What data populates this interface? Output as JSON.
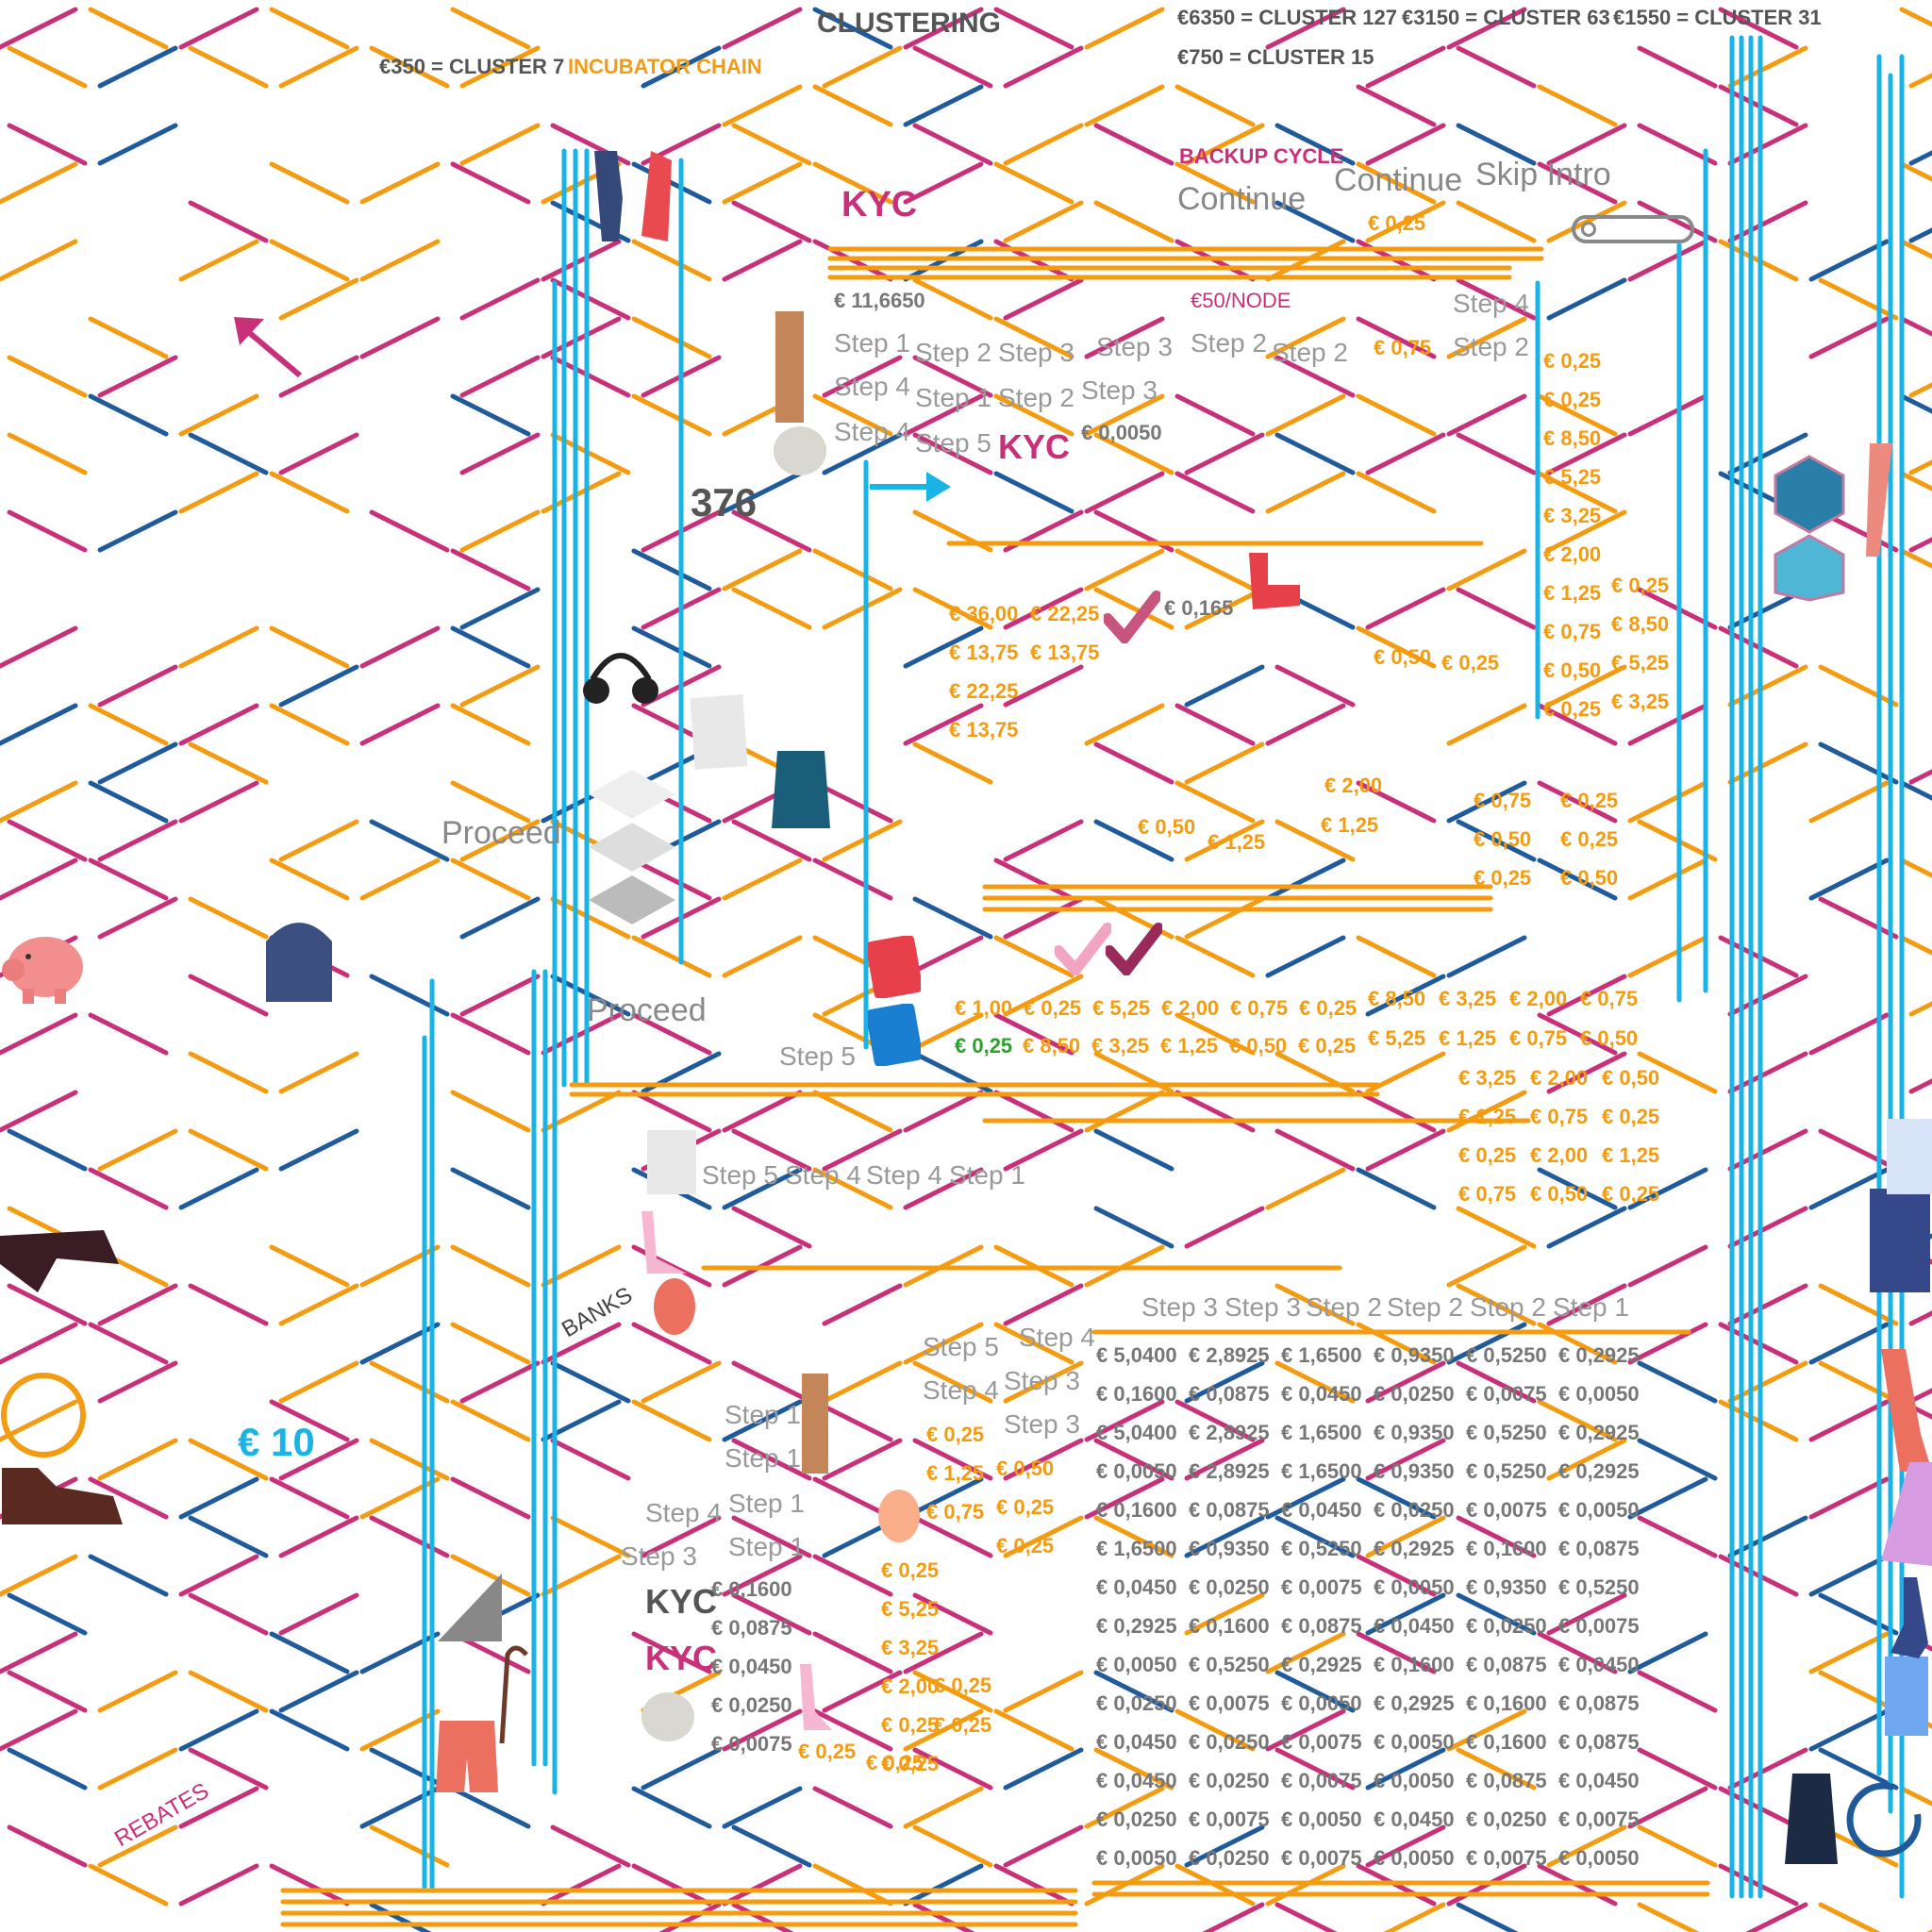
{
  "header": {
    "clustering": "CLUSTERING",
    "cluster7": "€350 = CLUSTER 7",
    "incubator_chain": "INCUBATOR CHAIN",
    "cluster127": "€6350 = CLUSTER 127",
    "cluster63": "€3150 = CLUSTER 63",
    "cluster31": "€1550 = CLUSTER 31",
    "cluster15": "€750 = CLUSTER 15"
  },
  "controls": {
    "backup_cycle": "BACKUP CYCLE",
    "continue_1": "Continue",
    "continue_2": "Continue",
    "skip_intro": "Skip Intro",
    "fee_025": "€ 0,25",
    "proceed_1": "Proceed",
    "proceed_2": "Proceed"
  },
  "labels": {
    "kyc": "KYC",
    "total": "€ 11,6650",
    "per_node": "€50/NODE",
    "small_fee": "€ 0,0050",
    "fee_0165": "€ 0,165",
    "count": "376",
    "banks": "BANKS",
    "rebates": "REBATES",
    "ten": "€ 10"
  },
  "steps_top": [
    "Step 1",
    "Step 4",
    "Step 4",
    "Step 2",
    "Step 1",
    "Step 5",
    "Step 3",
    "Step 2",
    "Step 3",
    "Step 3",
    "Step 2",
    "Step 2",
    "Step 4",
    "Step 2"
  ],
  "step5_mid": "Step 5",
  "steps_row": [
    "Step 5",
    "Step 4",
    "Step 4",
    "Step 1"
  ],
  "steps_row2": [
    "Step 3",
    "Step 3",
    "Step 2",
    "Step 2",
    "Step 2",
    "Step 1"
  ],
  "steps_lower": [
    "Step 5",
    "Step 4",
    "Step 4",
    "Step 3",
    "Step 3"
  ],
  "steps_left": [
    "Step 1",
    "Step 1",
    "Step 1",
    "Step 1",
    "Step 4",
    "Step 3"
  ],
  "amounts": {
    "top_075": "€ 0,75",
    "right_col": [
      "€ 0,25",
      "€ 0,25",
      "€ 8,50",
      "€ 5,25",
      "€ 3,25",
      "€ 2,00",
      "€ 1,25",
      "€ 0,75",
      "€ 0,50",
      "€ 0,25"
    ],
    "right_col2": [
      "€ 0,25",
      "€ 8,50",
      "€ 5,25",
      "€ 3,25"
    ],
    "mid_left": [
      [
        "€ 36,00",
        "€ 22,25"
      ],
      [
        "€ 13,75",
        "€ 13,75"
      ],
      [
        "€ 22,25"
      ],
      [
        "€ 13,75"
      ]
    ],
    "mid_050": "€ 0,50",
    "mid_025": "€ 0,25",
    "cluster_a": [
      "€ 2,00",
      "€ 1,25",
      "€ 0,50",
      "€ 1,25"
    ],
    "cluster_b": [
      [
        "€ 0,75",
        "€ 0,25"
      ],
      [
        "€ 0,50",
        "€ 0,25"
      ],
      [
        "€ 0,25",
        "€ 0,50"
      ]
    ],
    "row1": [
      "€ 1,00",
      "€ 0,25",
      "€ 5,25",
      "€ 2,00",
      "€ 0,75",
      "€ 0,25"
    ],
    "row2_green": "€ 0,25",
    "row2": [
      "€ 8,50",
      "€ 3,25",
      "€ 1,25",
      "€ 0,50",
      "€ 0,25"
    ],
    "row1b": [
      "€ 8,50",
      "€ 3,25",
      "€ 2,00",
      "€ 0,75"
    ],
    "row2b": [
      "€ 5,25",
      "€ 1,25",
      "€ 0,75",
      "€ 0,50"
    ],
    "stack_right": [
      [
        "€ 3,25",
        "€ 2,00",
        "€ 0,50"
      ],
      [
        "€ 1,25",
        "€ 0,75",
        "€ 0,25"
      ],
      [
        "€ 0,25",
        "€ 2,00",
        "€ 1,25"
      ],
      [
        "€ 0,75",
        "€ 0,50",
        "€ 0,25"
      ]
    ],
    "lower_mid": [
      "€ 0,25",
      "€ 1,25",
      "€ 0,75"
    ],
    "lower_mid2": [
      "€ 0,50",
      "€ 0,25",
      "€ 0,25"
    ],
    "lower_left_gray": [
      "€ 0,1600",
      "€ 0,0875",
      "€ 0,0450",
      "€ 0,0250",
      "€ 0,0075"
    ],
    "lower_org": [
      "€ 0,25",
      "€ 5,25",
      "€ 3,25",
      "€ 2,00",
      "€ 0,25",
      "€ 0,25"
    ],
    "lower_org2": [
      "€ 0,25",
      "€ 0,25",
      "€ 0,25",
      "€ 0,25"
    ]
  },
  "table": [
    [
      "€ 5,0400",
      "€ 2,8925",
      "€ 1,6500",
      "€ 0,9350",
      "€ 0,5250",
      "€ 0,2925"
    ],
    [
      "€ 0,1600",
      "€ 0,0875",
      "€ 0,0450",
      "€ 0,0250",
      "€ 0,0075",
      "€ 0,0050"
    ],
    [
      "€ 5,0400",
      "€ 2,8925",
      "€ 1,6500",
      "€ 0,9350",
      "€ 0,5250",
      "€ 0,2925"
    ],
    [
      "€ 0,0050",
      "€ 2,8925",
      "€ 1,6500",
      "€ 0,9350",
      "€ 0,5250",
      "€ 0,2925"
    ],
    [
      "€ 0,1600",
      "€ 0,0875",
      "€ 0,0450",
      "€ 0,0250",
      "€ 0,0075",
      "€ 0,0050"
    ],
    [
      "€ 1,6500",
      "€ 0,9350",
      "€ 0,5250",
      "€ 0,2925",
      "€ 0,1600",
      "€ 0,0875"
    ],
    [
      "€ 0,0450",
      "€ 0,0250",
      "€ 0,0075",
      "€ 0,0050",
      "€ 0,9350",
      "€ 0,5250"
    ],
    [
      "€ 0,2925",
      "€ 0,1600",
      "€ 0,0875",
      "€ 0,0450",
      "€ 0,0250",
      "€ 0,0075"
    ],
    [
      "€ 0,0050",
      "€ 0,5250",
      "€ 0,2925",
      "€ 0,1600",
      "€ 0,0875",
      "€ 0,0450"
    ],
    [
      "€ 0,0250",
      "€ 0,0075",
      "€ 0,0050",
      "€ 0,2925",
      "€ 0,1600",
      "€ 0,0875"
    ],
    [
      "€ 0,0450",
      "€ 0,0250",
      "€ 0,0075",
      "€ 0,0050",
      "€ 0,1600",
      "€ 0,0875"
    ],
    [
      "€ 0,0450",
      "€ 0,0250",
      "€ 0,0075",
      "€ 0,0050",
      "€ 0,0875",
      "€ 0,0450"
    ],
    [
      "€ 0,0250",
      "€ 0,0075",
      "€ 0,0050",
      "€ 0,0450",
      "€ 0,0250",
      "€ 0,0075"
    ],
    [
      "€ 0,0050",
      "€ 0,0250",
      "€ 0,0075",
      "€ 0,0050",
      "€ 0,0075",
      "€ 0,0050"
    ]
  ],
  "colors": {
    "magenta": "#c8307a",
    "orange": "#f39c12",
    "navy": "#1f5a9a",
    "cyan": "#1ab3e6",
    "gray": "#777777"
  }
}
